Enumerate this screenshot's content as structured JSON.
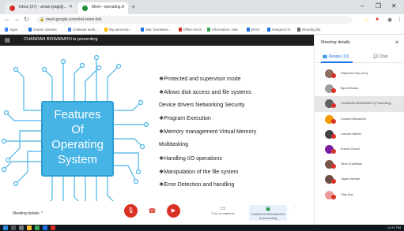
{
  "browser": {
    "tabs": [
      {
        "label": "Inbox (37) - aman.tyagi@...",
        "favicon_color": "#d93025"
      },
      {
        "label": "Meet - operating...",
        "favicon_color": "#1e8e3e"
      }
    ],
    "new_tab_glyph": "+",
    "window_controls": [
      "–",
      "❐",
      "✕"
    ],
    "url": "meet.google.com/xhd-xvmz-bxk",
    "bookmarks": [
      {
        "label": "Apps",
        "color": "#4285f4"
      },
      {
        "label": "Instant classes",
        "color": "#1a73e8"
      },
      {
        "label": "Cultivate work...",
        "color": "#4285f4"
      },
      {
        "label": "My personal...",
        "color": "#fbbc04"
      },
      {
        "label": "Mac hardware...",
        "color": "#1a73e8"
      },
      {
        "label": "Office Docs",
        "color": "#d93025"
      },
      {
        "label": "Information: rate",
        "color": "#34a853"
      },
      {
        "label": "BYUI",
        "color": "#1a73e8"
      },
      {
        "label": "Hangout rm",
        "color": "#1a73e8"
      },
      {
        "label": "Reading list",
        "color": "#666666"
      }
    ]
  },
  "presenter_bar": {
    "text": "CHANDAN BISWANATH is presenting"
  },
  "slide": {
    "chip_lines": [
      "Features",
      "Of",
      "Operating",
      "System"
    ],
    "chip_color": "#47b4e6",
    "bullets": [
      "❖Protected and supervisor mode",
      "❖Allows disk access and file systems",
      "Device drivers Networking Security",
      "❖Program Execution",
      "❖Memory management Virtual Memory",
      "Multitasking",
      "❖Handling I/O operations",
      "❖Manipulation of the file system",
      "❖Error Detection and handling"
    ]
  },
  "controls": {
    "meeting_details": "Meeting details",
    "turn_on_captions": "Turn on captions",
    "presenting": "CHANDAN BISWANATH is presenting"
  },
  "panel": {
    "title": "Meeting details",
    "tabs": [
      {
        "label": "People (13)"
      },
      {
        "label": "Chat"
      }
    ],
    "participants": [
      {
        "name": "Rajkumar Dey (You)",
        "color": "#8d6e63"
      },
      {
        "name": "Bipro Biswas",
        "color": "#9e9e9e"
      },
      {
        "name": "CHANDAN BISWANATH (Presenting)",
        "color": "#616161"
      },
      {
        "name": "Goutam Bhowmick",
        "color": "#f29900"
      },
      {
        "name": "Loknath Bakshi",
        "color": "#424242"
      },
      {
        "name": "Kushal Ghosh",
        "color": "#7b1fa2"
      },
      {
        "name": "Sima Chatterjee",
        "color": "#795548"
      },
      {
        "name": "Tapan Mondal",
        "color": "#6d4c41"
      },
      {
        "name": "Tilak Das",
        "color": "#ef9a9a"
      }
    ]
  },
  "taskbar": {
    "clock": "12:47 PM"
  }
}
